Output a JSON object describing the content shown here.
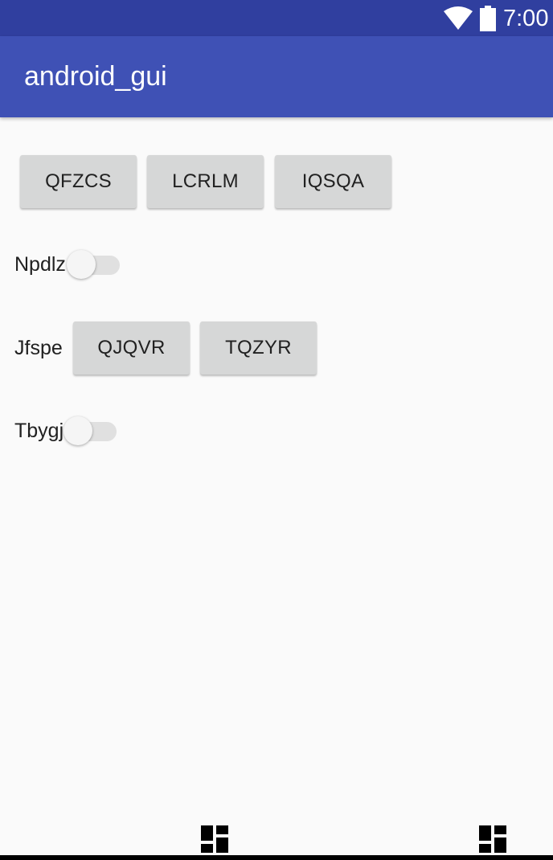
{
  "status_bar": {
    "time": "7:00",
    "icons": [
      "wifi-icon",
      "battery-icon"
    ],
    "background": "#303f9f"
  },
  "action_bar": {
    "title": "android_gui",
    "background": "#3f51b5"
  },
  "row1": {
    "buttons": [
      "QFZCS",
      "LCRLM",
      "IQSQA"
    ]
  },
  "row2": {
    "label": "Npdlz",
    "switch_on": false
  },
  "row3": {
    "label": "Jfspe",
    "buttons": [
      "QJQVR",
      "TQZYR"
    ]
  },
  "row4": {
    "label": "Tbygj",
    "switch_on": false
  },
  "bottom": {
    "icons": [
      "dashboard-icon",
      "dashboard-icon"
    ]
  },
  "colors": {
    "button": "#d6d7d7",
    "background": "#fafafa",
    "text": "#212121"
  }
}
